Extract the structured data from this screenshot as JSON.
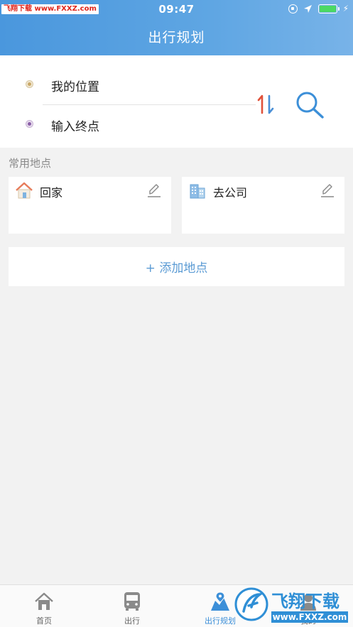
{
  "status_bar": {
    "time": "09:47",
    "watermark": "飞翔下载 www.FXXZ.com"
  },
  "header": {
    "title": "出行规划"
  },
  "route": {
    "start_label": "我的位置",
    "end_placeholder": "输入终点",
    "swap_icon": "swap-vertical-icon",
    "search_icon": "search-icon"
  },
  "common_places": {
    "label": "常用地点",
    "items": [
      {
        "name": "回家",
        "icon": "home-icon"
      },
      {
        "name": "去公司",
        "icon": "office-building-icon"
      }
    ],
    "add_label": "+ 添加地点"
  },
  "tabbar": {
    "items": [
      {
        "label": "首页",
        "icon": "home-icon",
        "active": false
      },
      {
        "label": "出行",
        "icon": "bus-icon",
        "active": false
      },
      {
        "label": "出行规划",
        "icon": "map-pin-icon",
        "active": true
      },
      {
        "label": "我的",
        "icon": "user-icon",
        "active": false
      }
    ]
  },
  "watermark_bottom": {
    "text": "飞翔下载",
    "url": "www.FXXZ.com"
  },
  "colors": {
    "header_gradient_start": "#4a97dd",
    "header_gradient_end": "#78b3e8",
    "accent_blue": "#3c8fd8",
    "add_text": "#5b9bd4",
    "background": "#f2f2f2"
  }
}
